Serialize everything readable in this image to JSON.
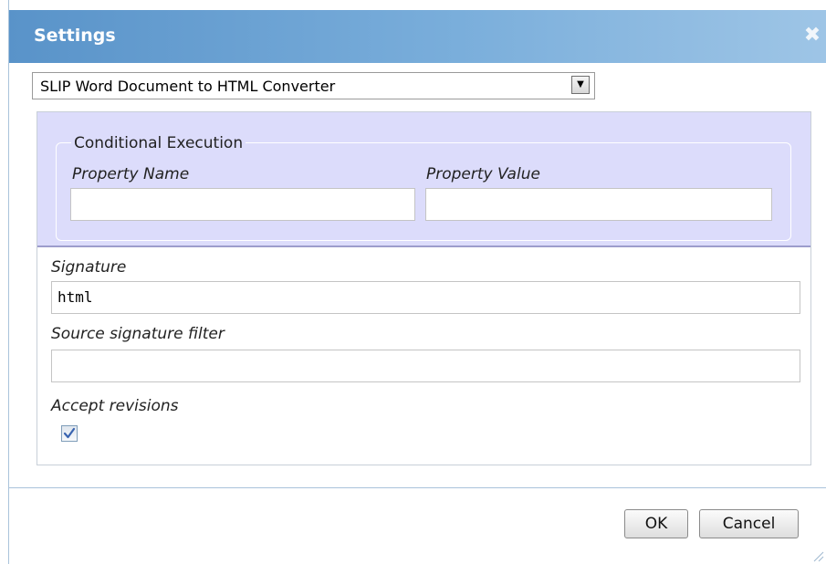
{
  "dialog": {
    "title": "Settings",
    "close_icon": "close-icon",
    "close_glyph": "✖"
  },
  "converter_select": {
    "selected": "SLIP Word Document to HTML Converter",
    "arrow_glyph": "▼"
  },
  "conditional_execution": {
    "legend": "Conditional Execution",
    "property_name_label": "Property Name",
    "property_name_value": "",
    "property_value_label": "Property Value",
    "property_value_value": ""
  },
  "signature": {
    "label": "Signature",
    "value": "html"
  },
  "source_signature_filter": {
    "label": "Source signature filter",
    "value": ""
  },
  "accept_revisions": {
    "label": "Accept revisions",
    "checked": true
  },
  "buttons": {
    "ok": "OK",
    "cancel": "Cancel"
  },
  "colors": {
    "titlebar_start": "#5993c9",
    "titlebar_end": "#9ec5e6",
    "conditional_background": "#dcdcfb",
    "checkmark": "#3a64b0"
  }
}
